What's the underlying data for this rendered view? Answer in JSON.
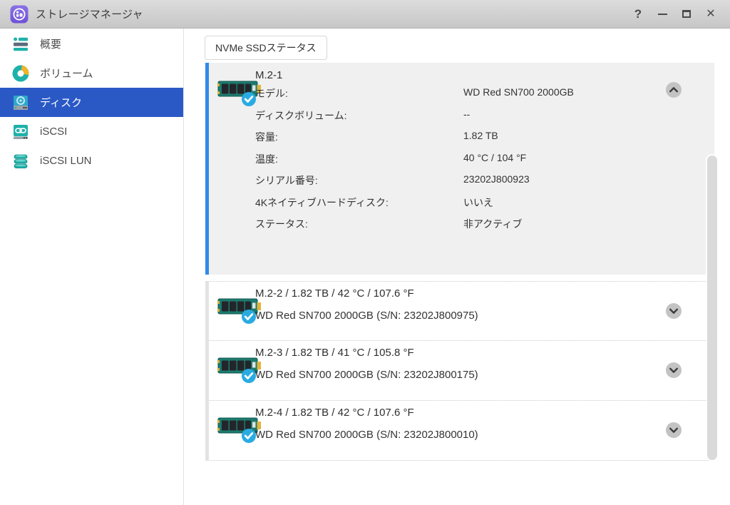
{
  "titlebar": {
    "title": "ストレージマネージャ",
    "help_label": "?",
    "close_label": "✕"
  },
  "sidebar": {
    "items": [
      {
        "label": "概要",
        "selected": false
      },
      {
        "label": "ボリューム",
        "selected": false
      },
      {
        "label": "ディスク",
        "selected": true
      },
      {
        "label": "iSCSI",
        "selected": false
      },
      {
        "label": "iSCSI LUN",
        "selected": false
      }
    ]
  },
  "content": {
    "tab_label": "NVMe SSDステータス"
  },
  "expanded_disk": {
    "name": "M.2-1",
    "details": [
      {
        "label": "モデル:",
        "value": "WD Red SN700 2000GB"
      },
      {
        "label": "ディスクボリューム:",
        "value": "--"
      },
      {
        "label": "容量:",
        "value": "1.82 TB"
      },
      {
        "label": "温度:",
        "value": "40 °C / 104 °F"
      },
      {
        "label": "シリアル番号:",
        "value": "23202J800923"
      },
      {
        "label": "4Kネイティブハードディスク:",
        "value": "いいえ"
      },
      {
        "label": "ステータス:",
        "value": "非アクティブ"
      }
    ]
  },
  "collapsed_disks": [
    {
      "title": "M.2-2 / 1.82 TB / 42 °C / 107.6 °F",
      "subtitle": "WD Red SN700 2000GB (S/N: 23202J800975)"
    },
    {
      "title": "M.2-3 / 1.82 TB / 41 °C / 105.8 °F",
      "subtitle": "WD Red SN700 2000GB (S/N: 23202J800175)"
    },
    {
      "title": "M.2-4 / 1.82 TB / 42 °C / 107.6 °F",
      "subtitle": "WD Red SN700 2000GB (S/N: 23202J800010)"
    }
  ],
  "icons": {
    "app": "storage-manager-app-icon",
    "overview": "overview-icon",
    "volume": "volume-donut-icon",
    "disk": "disk-drive-icon",
    "iscsi": "iscsi-link-icon",
    "iscsi_lun": "lun-stack-icon",
    "ssd": "m2-ssd-with-check-icon",
    "chevron_up": "chevron-up-icon",
    "chevron_down": "chevron-down-icon"
  },
  "colors": {
    "selected_sidebar_blue": "#2A59C6",
    "accent_bar_blue": "#2F8BE8",
    "teal": "#1FB1A9",
    "badge_blue": "#29ABE2",
    "expanded_card_gray": "#F0F0F0",
    "titlebar_gray": "#CDCDCD"
  }
}
